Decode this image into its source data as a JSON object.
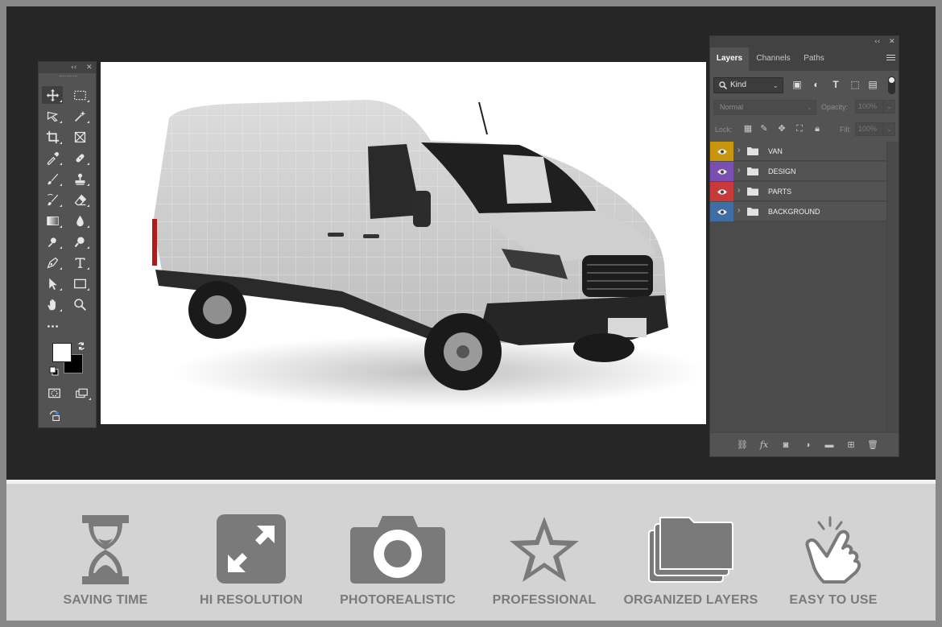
{
  "colors": {
    "workspace": "#262626",
    "panel": "#535353",
    "banner": "#d3d3d3",
    "feature_gray": "#7a7a7a"
  },
  "toolbox": {
    "collapse_glyph": "‹‹",
    "close_glyph": "✕",
    "tools": [
      {
        "icon": "move-icon"
      },
      {
        "icon": "marquee-icon"
      },
      {
        "icon": "lasso-icon"
      },
      {
        "icon": "magic-wand-icon"
      },
      {
        "icon": "crop-icon"
      },
      {
        "icon": "frame-icon"
      },
      {
        "icon": "eyedropper-icon"
      },
      {
        "icon": "healing-brush-icon"
      },
      {
        "icon": "brush-icon"
      },
      {
        "icon": "clone-stamp-icon"
      },
      {
        "icon": "history-brush-icon"
      },
      {
        "icon": "eraser-icon"
      },
      {
        "icon": "gradient-icon"
      },
      {
        "icon": "blur-icon"
      },
      {
        "icon": "dodge-icon"
      },
      {
        "icon": "zoom-lens-icon"
      },
      {
        "icon": "pen-icon"
      },
      {
        "icon": "type-icon"
      },
      {
        "icon": "path-select-icon"
      },
      {
        "icon": "rectangle-icon"
      },
      {
        "icon": "hand-icon"
      },
      {
        "icon": "zoom-icon"
      },
      {
        "icon": "more-tools-icon"
      }
    ],
    "foreground_color": "#ffffff",
    "background_color": "#000000"
  },
  "layers_panel": {
    "collapse_glyph": "‹‹",
    "close_glyph": "✕",
    "tabs": [
      {
        "label": "Layers",
        "active": true
      },
      {
        "label": "Channels",
        "active": false
      },
      {
        "label": "Paths",
        "active": false
      }
    ],
    "filter": {
      "selected": "Kind"
    },
    "blend_mode": "Normal",
    "opacity_label": "Opacity:",
    "opacity_value": "100%",
    "lock_label": "Lock:",
    "fill_label": "Fill:",
    "fill_value": "100%",
    "layers": [
      {
        "name": "VAN",
        "color": "#c8960c"
      },
      {
        "name": "DESIGN",
        "color": "#7a4fb0"
      },
      {
        "name": "PARTS",
        "color": "#c8393a"
      },
      {
        "name": "BACKGROUND",
        "color": "#3f6ea4"
      }
    ],
    "footer_icons": [
      "link-icon",
      "fx-icon",
      "mask-icon",
      "adjustment-icon",
      "group-icon",
      "new-layer-icon",
      "trash-icon"
    ]
  },
  "features": [
    {
      "label": "SAVING TIME",
      "icon": "hourglass-icon"
    },
    {
      "label": "HI RESOLUTION",
      "icon": "expand-arrows-icon"
    },
    {
      "label": "PHOTOREALISTIC",
      "icon": "camera-icon"
    },
    {
      "label": "PROFESSIONAL",
      "icon": "star-icon"
    },
    {
      "label": "ORGANIZED LAYERS",
      "icon": "stacked-folders-icon"
    },
    {
      "label": "EASY TO USE",
      "icon": "tap-hand-icon"
    }
  ],
  "canvas": {
    "subject": "cargo van mockup"
  }
}
